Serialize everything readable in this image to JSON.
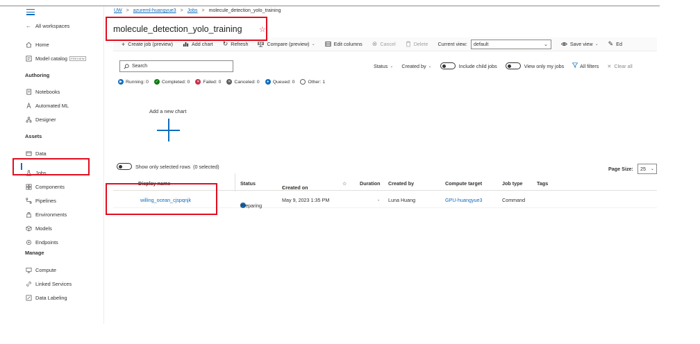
{
  "sidebar": {
    "workspaces_label": "All workspaces",
    "home": "Home",
    "model_catalog": "Model catalog",
    "preview_badge": "PREVIEW",
    "authoring_header": "Authoring",
    "notebooks": "Notebooks",
    "automated_ml": "Automated ML",
    "designer": "Designer",
    "assets_header": "Assets",
    "data": "Data",
    "jobs": "Jobs",
    "components": "Components",
    "pipelines": "Pipelines",
    "environments": "Environments",
    "models": "Models",
    "endpoints": "Endpoints",
    "manage_header": "Manage",
    "compute": "Compute",
    "linked_services": "Linked Services",
    "data_labeling": "Data Labeling"
  },
  "breadcrumb": {
    "root": "UW",
    "workspace": "azureml-huangyue3",
    "jobs": "Jobs",
    "current": "molecule_detection_yolo_training",
    "separator": ">"
  },
  "page": {
    "title": "molecule_detection_yolo_training"
  },
  "toolbar": {
    "create_job": "Create job (preview)",
    "add_chart": "Add chart",
    "refresh": "Refresh",
    "compare": "Compare (preview)",
    "edit_columns": "Edit columns",
    "cancel": "Cancel",
    "delete": "Delete",
    "current_view_label": "Current view:",
    "current_view_value": "default",
    "save_view": "Save view",
    "edit": "Ed"
  },
  "search": {
    "placeholder": "Search"
  },
  "filters": {
    "status": "Status",
    "created_by": "Created by",
    "include_child_jobs": "Include child jobs",
    "view_only_my_jobs": "View only my jobs",
    "all_filters": "All filters",
    "clear_all": "Clear all"
  },
  "status_summary": {
    "running": "Running: 0",
    "completed": "Completed: 0",
    "failed": "Failed: 0",
    "canceled": "Canceled: 0",
    "queued": "Queued: 0",
    "other": "Other: 1"
  },
  "chart": {
    "add_new_chart": "Add a new chart"
  },
  "table_controls": {
    "show_selected": "Show only selected rows",
    "selected_count": "(0 selected)",
    "page_size_label": "Page Size:",
    "page_size_value": "25"
  },
  "table": {
    "columns": {
      "display_name": "Display name",
      "status": "Status",
      "created_on": "Created on",
      "duration": "Duration",
      "created_by": "Created by",
      "compute_target": "Compute target",
      "job_type": "Job type",
      "tags": "Tags"
    },
    "rows": [
      {
        "display_name": "willing_ocean_cjspqnjk",
        "status": "Preparing",
        "created_on": "May 9, 2023 1:35 PM",
        "duration": "-",
        "created_by": "Luna Huang",
        "compute_target": "GPU-huangyue3",
        "job_type": "Command",
        "tags": ""
      }
    ]
  },
  "colors": {
    "accent": "#0f6cbd",
    "highlight": "#e00c1e",
    "completed": "#107c10",
    "failed": "#c4314b",
    "canceled": "#605e5c"
  }
}
